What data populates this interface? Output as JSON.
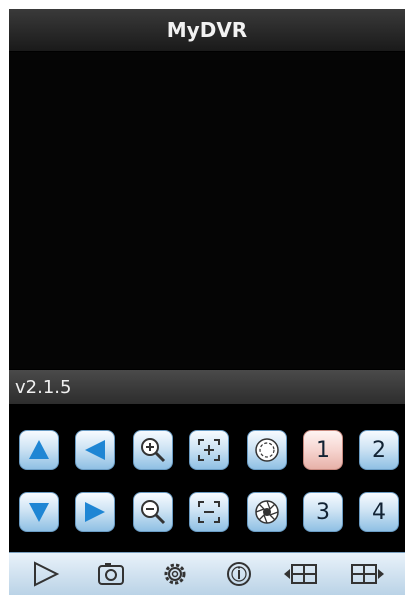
{
  "app": {
    "title": "MyDVR",
    "version": "v2.1.5"
  },
  "ptz": {
    "row1": [
      {
        "name": "tilt-up-button",
        "icon": "arrow-up-icon"
      },
      {
        "name": "pan-left-button",
        "icon": "arrow-left-icon"
      },
      {
        "name": "zoom-in-button",
        "icon": "zoom-in-icon"
      },
      {
        "name": "focus-near-button",
        "icon": "focus-plus-icon"
      },
      {
        "name": "iris-open-button",
        "icon": "iris-open-icon"
      },
      {
        "name": "channel-1-button",
        "label": "1",
        "active": true
      },
      {
        "name": "channel-2-button",
        "label": "2"
      }
    ],
    "row2": [
      {
        "name": "tilt-down-button",
        "icon": "arrow-down-icon"
      },
      {
        "name": "pan-right-button",
        "icon": "arrow-right-icon"
      },
      {
        "name": "zoom-out-button",
        "icon": "zoom-out-icon"
      },
      {
        "name": "focus-far-button",
        "icon": "focus-minus-icon"
      },
      {
        "name": "iris-close-button",
        "icon": "iris-close-icon"
      },
      {
        "name": "channel-3-button",
        "label": "3"
      },
      {
        "name": "channel-4-button",
        "label": "4"
      }
    ]
  },
  "toolbar": [
    {
      "name": "play-button",
      "icon": "play-icon"
    },
    {
      "name": "snapshot-button",
      "icon": "camera-icon"
    },
    {
      "name": "settings-button",
      "icon": "gear-icon"
    },
    {
      "name": "info-button",
      "icon": "info-icon"
    },
    {
      "name": "previous-view-button",
      "icon": "grid-prev-icon"
    },
    {
      "name": "next-view-button",
      "icon": "grid-next-icon"
    }
  ],
  "colors": {
    "accent": "#2a8fd6",
    "active": "#f6d5d0",
    "background": "#000000"
  }
}
